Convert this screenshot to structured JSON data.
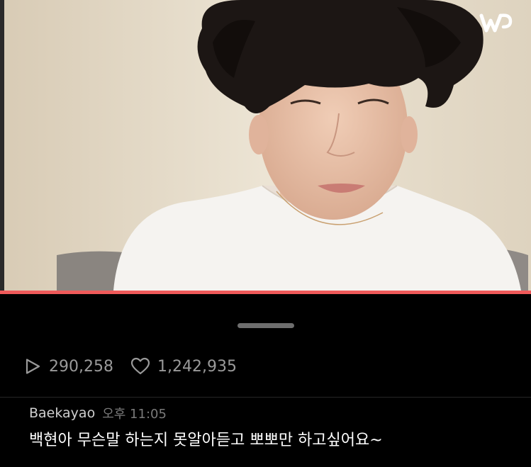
{
  "player": {
    "logo_icon": "weverse-w-icon",
    "progress_percent": 100,
    "progress_color": "#ef5a5a"
  },
  "stats": {
    "plays_icon": "play-icon",
    "plays": "290,258",
    "likes_icon": "heart-icon",
    "likes": "1,242,935"
  },
  "comment": {
    "author": "Baekayao",
    "time": "오후 11:05",
    "text": "백현아 무슨말 하는지 못알아듣고 뽀뽀만 하고싶어요~"
  }
}
